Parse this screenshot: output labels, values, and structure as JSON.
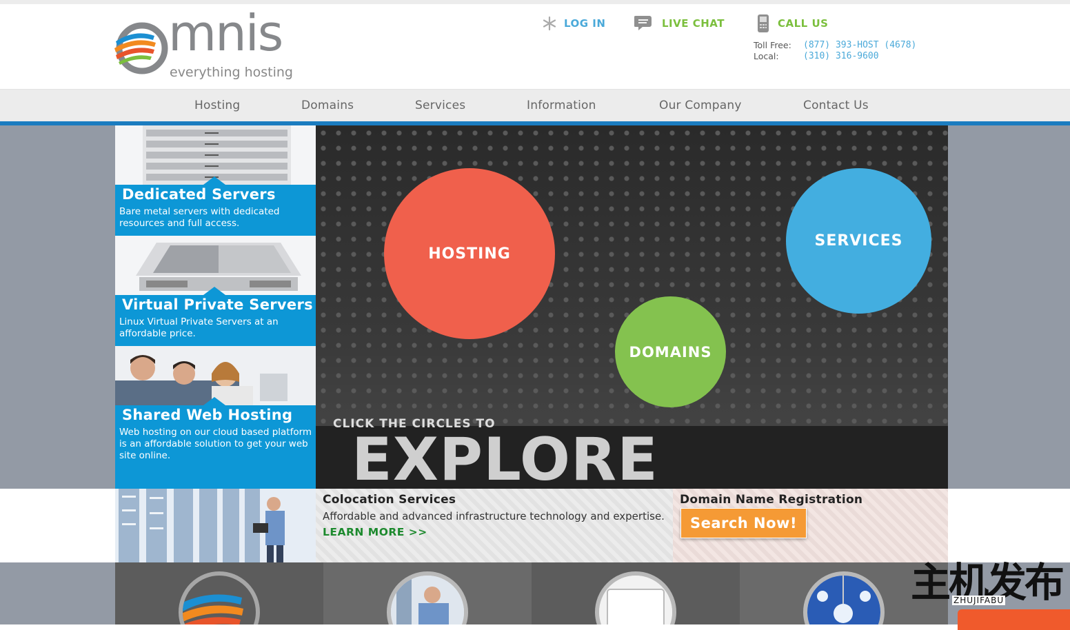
{
  "header": {
    "logo_word": "mnis",
    "logo_tagline": "everything hosting",
    "login_label": "LOG IN",
    "chat_label": "LIVE CHAT",
    "call_label": "CALL US",
    "toll_free_label": "Toll Free:",
    "toll_free_number": "(877) 393-HOST (4678)",
    "local_label": "Local:",
    "local_number": "(310) 316-9600"
  },
  "nav": {
    "items": [
      "Hosting",
      "Domains",
      "Services",
      "Information",
      "Our Company",
      "Contact Us"
    ]
  },
  "sidebar": {
    "cards": [
      {
        "title": "Dedicated Servers",
        "desc": "Bare metal servers with dedicated resources and full access."
      },
      {
        "title": "Virtual Private Servers",
        "desc": "Linux Virtual Private Servers at an affordable price."
      },
      {
        "title": "Shared Web Hosting",
        "desc": "Web hosting on our cloud based platform is an affordable solution to get your web site online."
      }
    ]
  },
  "hero": {
    "circles": [
      "HOSTING",
      "DOMAINS",
      "SERVICES"
    ],
    "click_text": "CLICK THE CIRCLES TO",
    "explore_text": "EXPLORE"
  },
  "promo": {
    "colo_title": "Colocation Services",
    "colo_desc": "Affordable and advanced infrastructure technology and expertise.",
    "colo_link": "LEARN MORE >>",
    "domain_title": "Domain Name Registration",
    "domain_button": "Search Now!"
  },
  "watermark": {
    "cn": "主机发布",
    "en": "ZHUJIFABU"
  },
  "colors": {
    "nav_blue": "#1b7cc0",
    "card_blue": "#0d97d6",
    "hosting_red": "#f0604c",
    "domains_green": "#84c24f",
    "services_blue": "#43aee0",
    "search_orange": "#f59a35",
    "link_green": "#1d8a2e"
  }
}
